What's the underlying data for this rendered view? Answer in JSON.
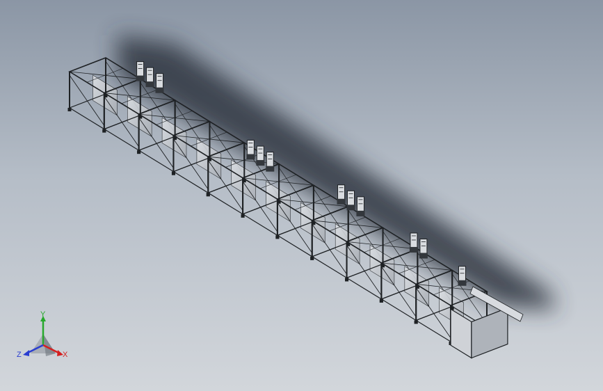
{
  "triad": {
    "x_label": "X",
    "y_label": "Y",
    "z_label": "Z",
    "x_color": "#d42020",
    "y_color": "#27a82c",
    "z_color": "#2a3ed0"
  },
  "colors": {
    "background_top": "#8b96a5",
    "background_bottom": "#d2d6db",
    "frame_fill": "#c9ccd1",
    "frame_edge": "#1e2124",
    "shadow": "#2e3440"
  }
}
